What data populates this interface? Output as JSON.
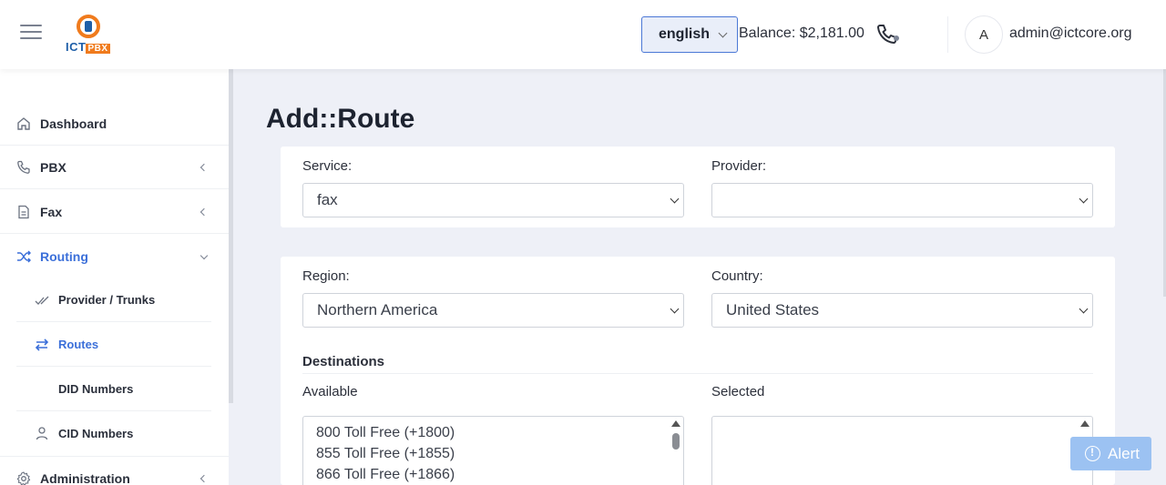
{
  "header": {
    "logo_text": "ICTPBX",
    "language": "english",
    "balance": "Balance: $2,181.00",
    "avatar_initial": "A",
    "username": "admin@ictcore.org"
  },
  "sidebar": {
    "items": [
      {
        "label": "Dashboard",
        "icon": "home-icon"
      },
      {
        "label": "PBX",
        "icon": "phone-icon"
      },
      {
        "label": "Fax",
        "icon": "document-icon"
      },
      {
        "label": "Routing",
        "icon": "shuffle-icon"
      },
      {
        "label": "Administration",
        "icon": "gear-icon"
      }
    ],
    "routing_sub": [
      {
        "label": "Provider / Trunks",
        "icon": "checks-icon"
      },
      {
        "label": "Routes",
        "icon": "swap-arrows-icon"
      },
      {
        "label": "DID Numbers",
        "icon": ""
      },
      {
        "label": "CID Numbers",
        "icon": "user-icon"
      }
    ]
  },
  "main": {
    "title": "Add::Route",
    "service_label": "Service:",
    "service_value": "fax",
    "provider_label": "Provider:",
    "provider_value": "",
    "region_label": "Region:",
    "region_value": "Northern America",
    "country_label": "Country:",
    "country_value": "United States",
    "destinations_title": "Destinations",
    "available_label": "Available",
    "selected_label": "Selected",
    "available_options": [
      "800 Toll Free (+1800)",
      "855 Toll Free (+1855)",
      "866 Toll Free (+1866)"
    ]
  },
  "alert_label": "Alert",
  "colors": {
    "accent": "#3b6fd9",
    "alert": "#9cc2f2",
    "logo_orange": "#f07b1d",
    "logo_blue": "#1f5fa8"
  }
}
